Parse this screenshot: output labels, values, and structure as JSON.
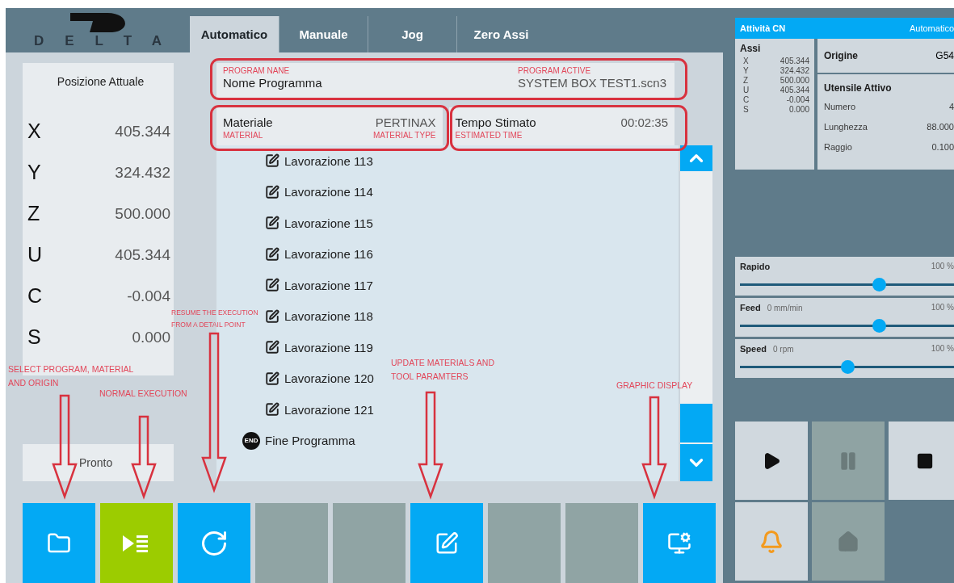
{
  "logo": {
    "text": "DELTA"
  },
  "tabs": [
    {
      "label": "Automatico",
      "selected": true
    },
    {
      "label": "Manuale",
      "selected": false
    },
    {
      "label": "Jog",
      "selected": false
    },
    {
      "label": "Zero Assi",
      "selected": false
    }
  ],
  "position": {
    "title": "Posizione Attuale",
    "axes": [
      {
        "axis": "X",
        "value": "405.344"
      },
      {
        "axis": "Y",
        "value": "324.432"
      },
      {
        "axis": "Z",
        "value": "500.000"
      },
      {
        "axis": "U",
        "value": "405.344"
      },
      {
        "axis": "C",
        "value": "-0.004"
      },
      {
        "axis": "S",
        "value": "0.000"
      }
    ]
  },
  "status": "Pronto",
  "program": {
    "caption": "PROGRAM NANE",
    "label": "Nome Programma",
    "value_caption": "PROGRAM ACTIVE",
    "value": "SYSTEM BOX TEST1.scn3"
  },
  "material": {
    "label": "Materiale",
    "caption": "MATERIAL",
    "value": "PERTINAX",
    "value_caption": "MATERIAL TYPE"
  },
  "time": {
    "label": "Tempo Stimato",
    "caption": "ESTIMATED TIME",
    "value": "00:02:35"
  },
  "operations": [
    {
      "kind": "operation",
      "label": "Lavorazione 113"
    },
    {
      "kind": "operation",
      "label": "Lavorazione 114"
    },
    {
      "kind": "operation",
      "label": "Lavorazione 115"
    },
    {
      "kind": "operation",
      "label": "Lavorazione 116"
    },
    {
      "kind": "operation",
      "label": "Lavorazione 117"
    },
    {
      "kind": "operation",
      "label": "Lavorazione 118"
    },
    {
      "kind": "operation",
      "label": "Lavorazione 119"
    },
    {
      "kind": "operation",
      "label": "Lavorazione 120"
    },
    {
      "kind": "operation",
      "label": "Lavorazione 121"
    },
    {
      "kind": "end",
      "badge": "END",
      "label": "Fine Programma"
    }
  ],
  "toolbar": [
    {
      "kind": "folder",
      "color": "#03a9f4"
    },
    {
      "kind": "run",
      "color": "#9ccc00"
    },
    {
      "kind": "resume",
      "color": "#03a9f4"
    },
    {
      "kind": "empty",
      "color": "#90a4a4"
    },
    {
      "kind": "empty",
      "color": "#90a4a4"
    },
    {
      "kind": "edit",
      "color": "#03a9f4"
    },
    {
      "kind": "empty",
      "color": "#90a4a4"
    },
    {
      "kind": "empty",
      "color": "#90a4a4"
    },
    {
      "kind": "display",
      "color": "#03a9f4"
    }
  ],
  "cn": {
    "title": "Attività CN",
    "mode": "Automatico",
    "assi": {
      "title": "Assi",
      "axes": [
        {
          "axis": "X",
          "value": "405.344"
        },
        {
          "axis": "Y",
          "value": "324.432"
        },
        {
          "axis": "Z",
          "value": "500.000"
        },
        {
          "axis": "U",
          "value": "405.344"
        },
        {
          "axis": "C",
          "value": "-0.004"
        },
        {
          "axis": "S",
          "value": "0.000"
        }
      ]
    },
    "origin": {
      "label": "Origine",
      "value": "G54"
    },
    "tool": {
      "title": "Utensile Attivo",
      "fields": [
        {
          "label": "Numero",
          "value": "4"
        },
        {
          "label": "Lunghezza",
          "value": "88.000"
        },
        {
          "label": "Raggio",
          "value": "0.100"
        }
      ]
    }
  },
  "overrides": [
    {
      "name": "Rapido",
      "percent": "100 %",
      "level": 0.65
    },
    {
      "name": "Feed",
      "reading": "0 mm/min",
      "percent": "100 %",
      "level": 0.65
    },
    {
      "name": "Speed",
      "reading": "0 rpm",
      "percent": "100 %",
      "level": 0.5
    }
  ],
  "controls": [
    {
      "kind": "play",
      "disabled": false
    },
    {
      "kind": "pause",
      "disabled": true
    },
    {
      "kind": "stop",
      "disabled": false
    },
    {
      "kind": "bell",
      "disabled": false
    },
    {
      "kind": "home",
      "disabled": true
    }
  ],
  "notes": [
    {
      "text": "SELECT PROGRAM, MATERIAL AND ORIGIN"
    },
    {
      "text": "NORMAL EXECUTION"
    },
    {
      "text": "RESUME THE EXECUTION FROM A DETAIL POINT"
    },
    {
      "text": "UPDATE MATERIALS AND TOOL PARAMTERS"
    },
    {
      "text": "GRAPHIC DISPLAY"
    }
  ]
}
